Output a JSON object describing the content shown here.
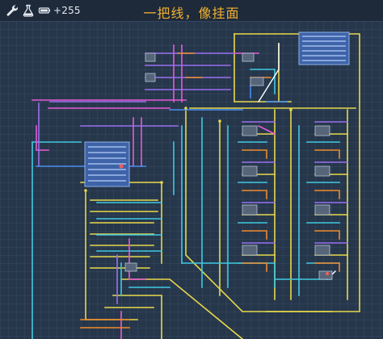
{
  "toolbar": {
    "tool_icon": "wrench-icon",
    "lab_icon": "flask-icon",
    "battery_icon": "battery-icon",
    "counter": "+255"
  },
  "title": "一把线，像挂面",
  "colors": {
    "background": "#26374c",
    "topbar": "#1e2a3a",
    "title": "#f2b133",
    "wire_yellow": "#e8d84a",
    "wire_cyan": "#3ec9e0",
    "wire_pink": "#e85ad6",
    "wire_purple": "#9b6ff0",
    "wire_orange": "#f08a2a",
    "wire_blue": "#4a8df0",
    "module_fill": "#3e63a8"
  }
}
